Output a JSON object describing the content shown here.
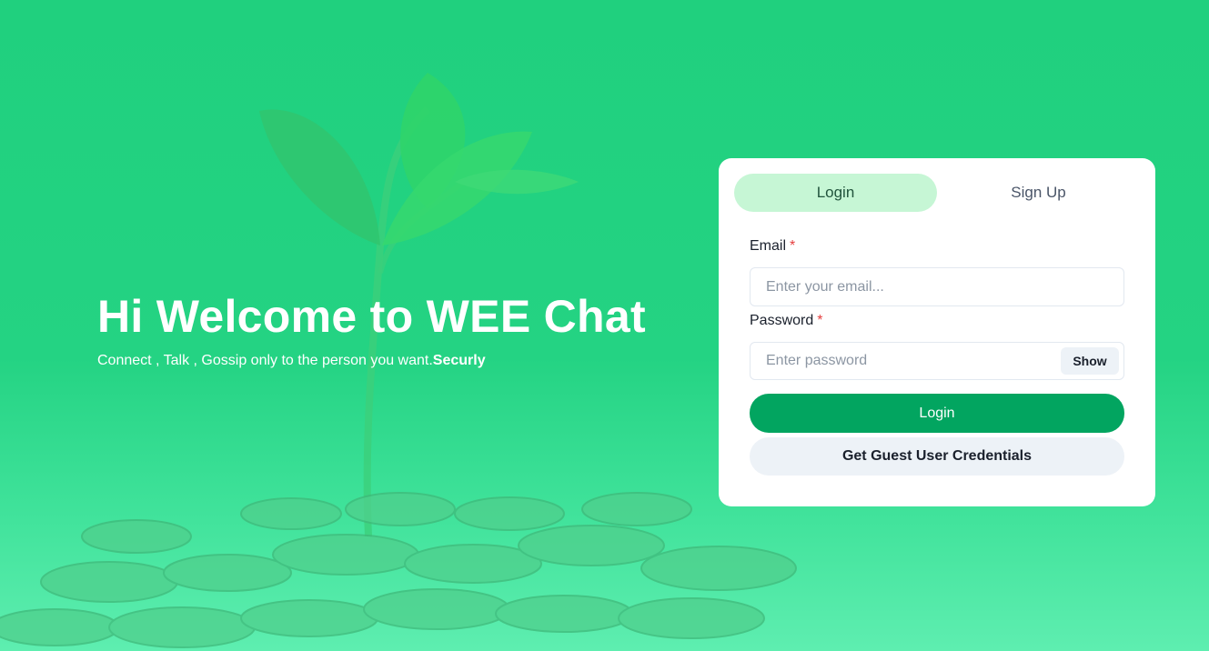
{
  "hero": {
    "title": "Hi Welcome to WEE Chat",
    "subtitle": "Connect , Talk , Gossip only to the person you want.",
    "subtitle_emphasis": "Securly"
  },
  "auth": {
    "tabs": [
      {
        "label": "Login",
        "active": true
      },
      {
        "label": "Sign Up",
        "active": false
      }
    ],
    "email": {
      "label": "Email",
      "required_mark": "*",
      "placeholder": "Enter your email...",
      "value": ""
    },
    "password": {
      "label": "Password",
      "required_mark": "*",
      "placeholder": "Enter password",
      "value": "",
      "toggle_label": "Show"
    },
    "login_button": "Login",
    "guest_button": "Get Guest User Credentials"
  },
  "colors": {
    "background": "#22d180",
    "primary_button": "#02a560",
    "active_tab": "#c6f6d5",
    "required": "#e53e3e"
  }
}
